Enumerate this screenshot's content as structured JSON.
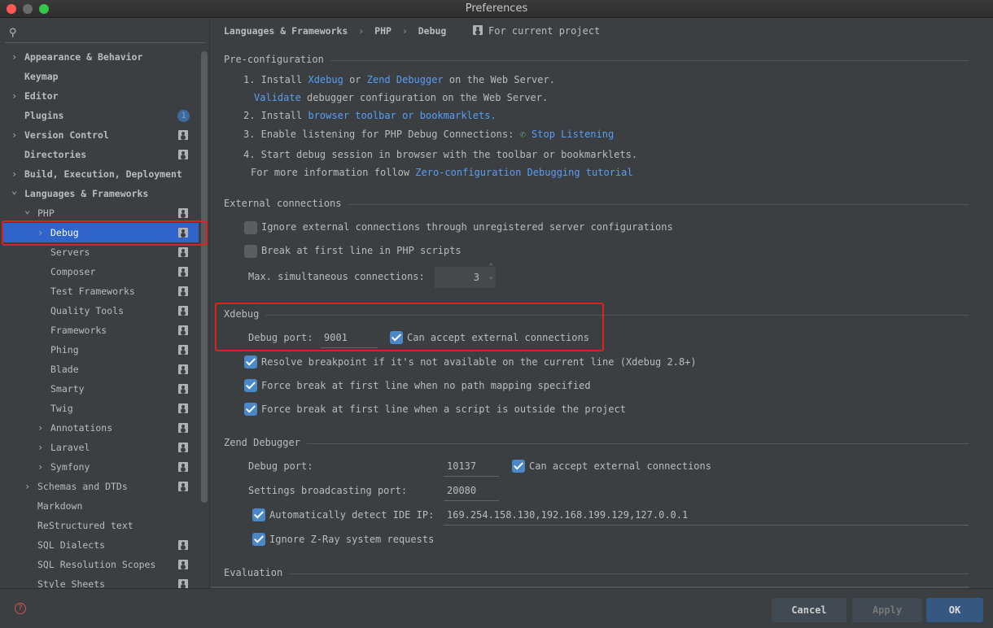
{
  "window": {
    "title": "Preferences"
  },
  "search": {
    "icon": "search-icon"
  },
  "sidebar": {
    "items": [
      {
        "label": "Appearance & Behavior",
        "level": 0,
        "chevron": "right",
        "bold": true
      },
      {
        "label": "Keymap",
        "level": 0,
        "bold": true
      },
      {
        "label": "Editor",
        "level": 0,
        "chevron": "right",
        "bold": true
      },
      {
        "label": "Plugins",
        "level": 0,
        "bold": true,
        "badge": "1"
      },
      {
        "label": "Version Control",
        "level": 0,
        "chevron": "right",
        "bold": true,
        "project": true
      },
      {
        "label": "Directories",
        "level": 0,
        "bold": true,
        "project": true
      },
      {
        "label": "Build, Execution, Deployment",
        "level": 0,
        "chevron": "right",
        "bold": true
      },
      {
        "label": "Languages & Frameworks",
        "level": 0,
        "chevron": "down",
        "bold": true
      },
      {
        "label": "PHP",
        "level": 1,
        "chevron": "down",
        "project": true
      },
      {
        "label": "Debug",
        "level": 2,
        "chevron": "right",
        "project": true,
        "selected": true
      },
      {
        "label": "Servers",
        "level": 2,
        "project": true
      },
      {
        "label": "Composer",
        "level": 2,
        "project": true
      },
      {
        "label": "Test Frameworks",
        "level": 2,
        "project": true
      },
      {
        "label": "Quality Tools",
        "level": 2,
        "project": true
      },
      {
        "label": "Frameworks",
        "level": 2,
        "project": true
      },
      {
        "label": "Phing",
        "level": 2,
        "project": true
      },
      {
        "label": "Blade",
        "level": 2,
        "project": true
      },
      {
        "label": "Smarty",
        "level": 2,
        "project": true
      },
      {
        "label": "Twig",
        "level": 2,
        "project": true
      },
      {
        "label": "Annotations",
        "level": 2,
        "chevron": "right",
        "project": true
      },
      {
        "label": "Laravel",
        "level": 2,
        "chevron": "right",
        "project": true
      },
      {
        "label": "Symfony",
        "level": 2,
        "chevron": "right",
        "project": true
      },
      {
        "label": "Schemas and DTDs",
        "level": 1,
        "chevron": "right",
        "project": true
      },
      {
        "label": "Markdown",
        "level": 1
      },
      {
        "label": "ReStructured text",
        "level": 1
      },
      {
        "label": "SQL Dialects",
        "level": 1,
        "project": true
      },
      {
        "label": "SQL Resolution Scopes",
        "level": 1,
        "project": true
      },
      {
        "label": "Style Sheets",
        "level": 1,
        "project": true
      }
    ]
  },
  "breadcrumb": {
    "items": [
      "Languages & Frameworks",
      "PHP",
      "Debug"
    ],
    "scope": "For current project"
  },
  "preconfig": {
    "title": "Pre-configuration",
    "l1a": "1. Install ",
    "l1_xdebug": "Xdebug",
    "l1b": " or ",
    "l1_zend": "Zend Debugger",
    "l1c": " on the Web Server.",
    "l2_validate": "Validate",
    "l2b": " debugger configuration on the Web Server.",
    "l3a": "2. Install ",
    "l3_link": "browser toolbar or bookmarklets.",
    "l4a": "3. Enable listening for PHP Debug Connections:",
    "l4_link": "Stop Listening",
    "l5": "4. Start debug session in browser with the toolbar or bookmarklets.",
    "l6a": "For more information follow ",
    "l6_link": "Zero-configuration Debugging tutorial"
  },
  "external": {
    "title": "External connections",
    "ignore": {
      "label": "Ignore external connections through unregistered server configurations",
      "checked": false
    },
    "break_first": {
      "label": "Break at first line in PHP scripts",
      "checked": false
    },
    "max_label": "Max. simultaneous connections:",
    "max_value": "3"
  },
  "xdebug": {
    "title": "Xdebug",
    "port_label": "Debug port:",
    "port": "9001",
    "accept": {
      "label": "Can accept external connections",
      "checked": true
    },
    "resolve": {
      "label": "Resolve breakpoint if it's not available on the current line (Xdebug 2.8+)",
      "checked": true
    },
    "force_nopath": {
      "label": "Force break at first line when no path mapping specified",
      "checked": true
    },
    "force_outside": {
      "label": "Force break at first line when a script is outside the project",
      "checked": true
    }
  },
  "zend": {
    "title": "Zend Debugger",
    "port_label": "Debug port:",
    "port": "10137",
    "accept": {
      "label": "Can accept external connections",
      "checked": true
    },
    "broadcast_label": "Settings broadcasting port:",
    "broadcast": "20080",
    "detect": {
      "label": "Automatically detect IDE IP:",
      "checked": true
    },
    "ip": "169.254.158.130,192.168.199.129,127.0.0.1",
    "zray": {
      "label": "Ignore Z-Ray system requests",
      "checked": true
    }
  },
  "evaluation": {
    "title": "Evaluation"
  },
  "footer": {
    "help_icon": "help-icon",
    "cancel": "Cancel",
    "apply": "Apply",
    "ok": "OK"
  },
  "colors": {
    "accent": "#2f65ca",
    "link": "#589df6",
    "highlight": "#e02020",
    "ok": "#365880"
  }
}
